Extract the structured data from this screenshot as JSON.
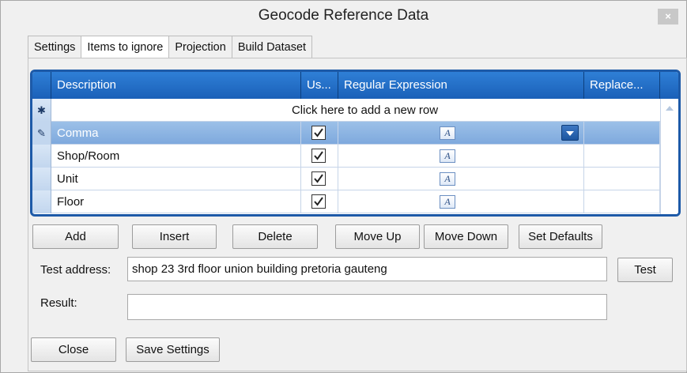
{
  "window": {
    "title": "Geocode Reference Data",
    "close_label": "×"
  },
  "tabs": [
    {
      "label": "Settings",
      "active": false
    },
    {
      "label": "Items to ignore",
      "active": true
    },
    {
      "label": "Projection",
      "active": false
    },
    {
      "label": "Build Dataset",
      "active": false
    }
  ],
  "grid": {
    "columns": [
      "Description",
      "Us...",
      "Regular Expression",
      "Replace..."
    ],
    "new_row_text": "Click here to add a new row",
    "new_row_marker": "✱",
    "edit_marker": "✎",
    "rows": [
      {
        "description": "Comma",
        "use": true,
        "selected": true
      },
      {
        "description": "Shop/Room",
        "use": true,
        "selected": false
      },
      {
        "description": "Unit",
        "use": true,
        "selected": false
      },
      {
        "description": "Floor",
        "use": true,
        "selected": false
      }
    ],
    "regex_icon_glyph": "A"
  },
  "actions": {
    "add": "Add",
    "insert": "Insert",
    "delete": "Delete",
    "move_up": "Move Up",
    "move_down": "Move Down",
    "set_defaults": "Set Defaults"
  },
  "test": {
    "label": "Test address:",
    "value": "shop 23 3rd floor union building pretoria gauteng",
    "button": "Test"
  },
  "result": {
    "label": "Result:",
    "value": ""
  },
  "footer": {
    "close": "Close",
    "save": "Save Settings"
  },
  "colors": {
    "header_blue": "#1d5aa8",
    "selection_blue": "#8cb4e3"
  }
}
